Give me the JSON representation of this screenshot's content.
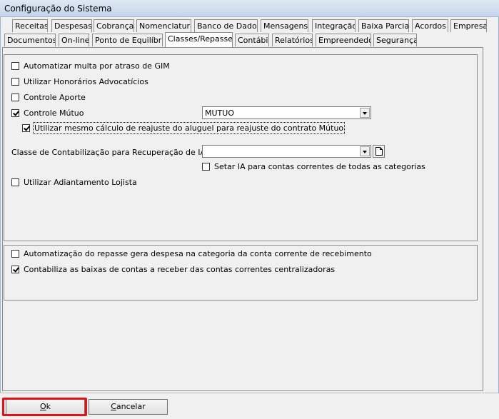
{
  "window": {
    "title": "Configuração do Sistema"
  },
  "tabs_row1": [
    "Receitas",
    "Despesas",
    "Cobrança",
    "Nomenclatura",
    "Banco de Dados",
    "Mensagens",
    "Integração",
    "Baixa Parcial",
    "Acordos",
    "Empresa"
  ],
  "tabs_row2": [
    "Documentos",
    "On-line",
    "Ponto de Equilíbrio",
    "Classes/Repasse",
    "Contábil",
    "Relatórios",
    "Empreendedor",
    "Segurança"
  ],
  "active_tab": "Classes/Repasse",
  "group1": {
    "options": [
      {
        "label": "Automatizar multa por atraso de GIM",
        "checked": false
      },
      {
        "label": "Utilizar Honorários Advocatícios",
        "checked": false
      },
      {
        "label": "Controle Aporte",
        "checked": false
      },
      {
        "label": "Controle Mútuo",
        "checked": true
      },
      {
        "label": "Utilizar mesmo cálculo de reajuste do aluguel para reajuste do contrato Mútuo",
        "checked": true
      },
      {
        "label": "Utilizar Adiantamento Lojista",
        "checked": false
      }
    ],
    "mutuo_combo_value": "MUTUO",
    "classe_label": "Classe de Contabilização para Recuperação de IA",
    "classe_combo_value": "",
    "setar_ia": {
      "label": "Setar IA para contas correntes de todas as categorias",
      "checked": false
    }
  },
  "group2": {
    "options": [
      {
        "label": "Automatização do repasse gera despesa na categoria da conta corrente de recebimento",
        "checked": false
      },
      {
        "label": "Contabiliza as baixas de contas a receber das contas correntes centralizadoras",
        "checked": true
      }
    ]
  },
  "buttons": {
    "ok": {
      "accel": "O",
      "rest": "k"
    },
    "cancel": {
      "accel": "C",
      "rest": "ancelar"
    }
  },
  "accent": {
    "highlight": "#e0131a",
    "titlebar": "#c4d5ea"
  }
}
